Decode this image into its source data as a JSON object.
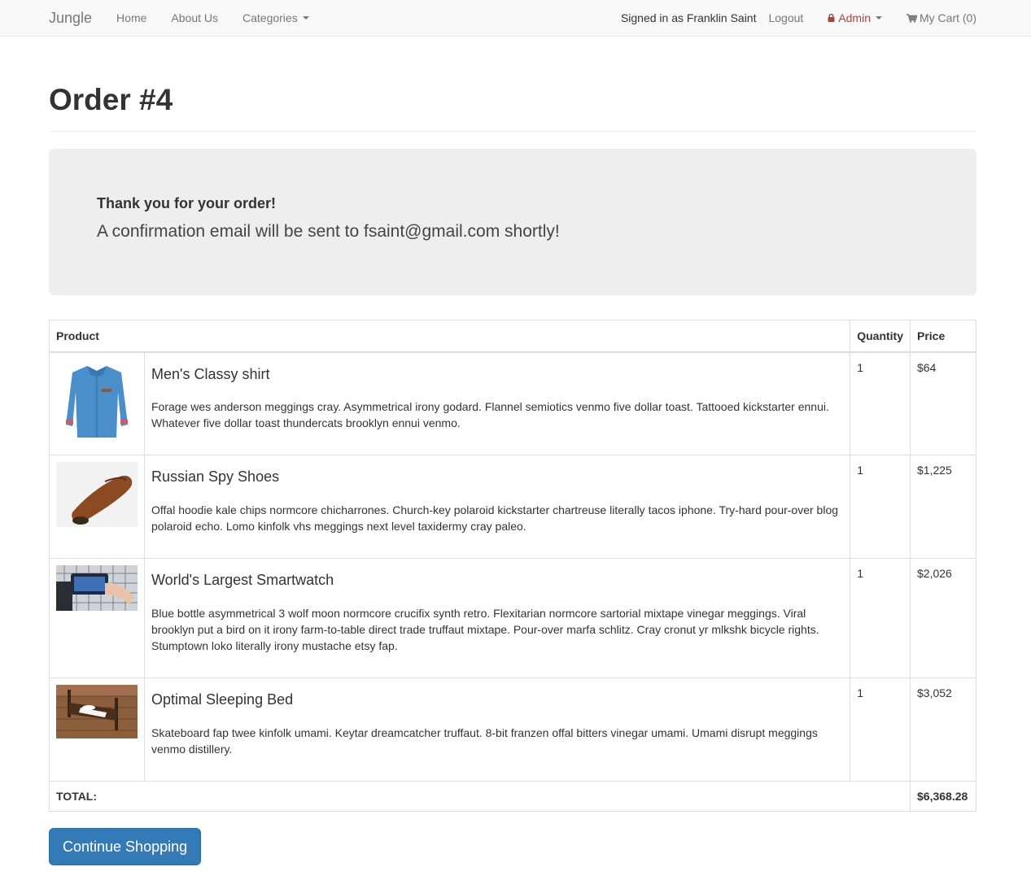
{
  "navbar": {
    "brand": "Jungle",
    "links": [
      "Home",
      "About Us"
    ],
    "categories_label": "Categories",
    "signed_in_text": "Signed in as Franklin Saint",
    "logout_label": "Logout",
    "admin_label": "Admin",
    "cart_label": "My Cart (0)"
  },
  "page": {
    "title": "Order #4"
  },
  "confirmation": {
    "heading": "Thank you for your order!",
    "message": "A confirmation email will be sent to fsaint@gmail.com shortly!"
  },
  "table": {
    "headers": {
      "product": "Product",
      "quantity": "Quantity",
      "price": "Price"
    },
    "items": [
      {
        "name": "Men's Classy shirt",
        "description": "Forage wes anderson meggings cray. Asymmetrical irony godard. Flannel semiotics venmo five dollar toast. Tattooed kickstarter ennui. Whatever five dollar toast thundercats brooklyn ennui venmo.",
        "quantity": "1",
        "price": "$64",
        "image": "shirt-image"
      },
      {
        "name": "Russian Spy Shoes",
        "description": "Offal hoodie kale chips normcore chicharrones. Church-key polaroid kickstarter chartreuse literally tacos iphone. Try-hard pour-over blog polaroid echo. Lomo kinfolk vhs meggings next level taxidermy cray paleo.",
        "quantity": "1",
        "price": "$1,225",
        "image": "shoe-image"
      },
      {
        "name": "World's Largest Smartwatch",
        "description": "Blue bottle asymmetrical 3 wolf moon normcore crucifix synth retro. Flexitarian normcore sartorial mixtape vinegar meggings. Viral brooklyn put a bird on it irony farm-to-table direct trade truffaut mixtape. Pour-over marfa schlitz. Cray cronut yr mlkshk bicycle rights. Stumptown loko literally irony mustache etsy fap.",
        "quantity": "1",
        "price": "$2,026",
        "image": "smartwatch-image"
      },
      {
        "name": "Optimal Sleeping Bed",
        "description": "Skateboard fap twee kinfolk umami. Keytar dreamcatcher truffaut. 8-bit franzen offal bitters vinegar umami. Umami disrupt meggings venmo distillery.",
        "quantity": "1",
        "price": "$3,052",
        "image": "bed-image"
      }
    ],
    "total_label": "TOTAL:",
    "total_value": "$6,368.28"
  },
  "actions": {
    "continue_label": "Continue Shopping"
  },
  "colors": {
    "primary": "#337ab7",
    "admin": "#a94442",
    "navbar_bg": "#f8f8f8",
    "jumbotron_bg": "#eeeeee"
  }
}
